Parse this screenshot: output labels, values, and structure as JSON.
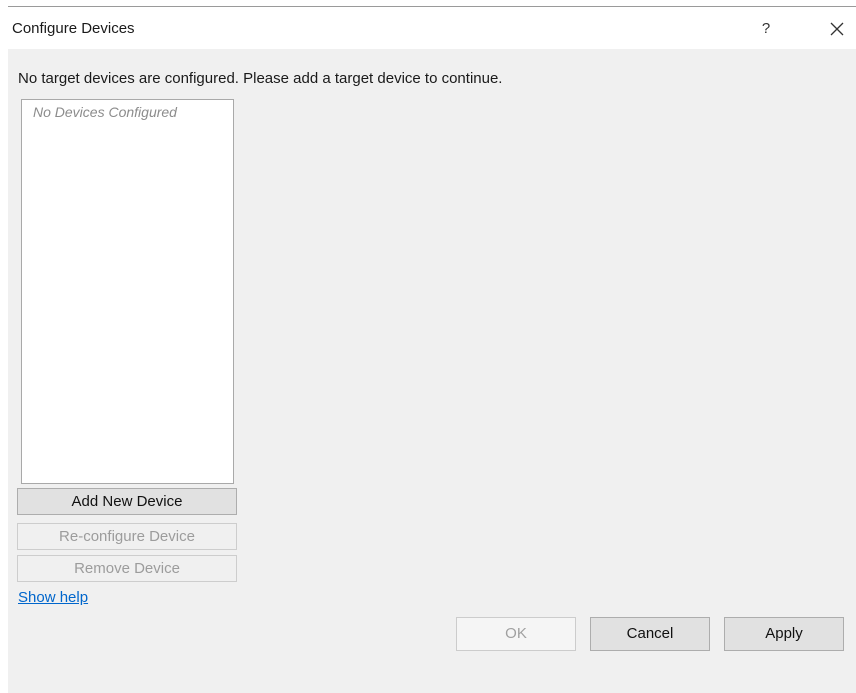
{
  "window": {
    "title": "Configure Devices",
    "help_label": "?",
    "close_icon": "close-icon"
  },
  "message": "No target devices are configured. Please add a target device to continue.",
  "device_list": {
    "empty_text": "No Devices Configured",
    "items": []
  },
  "buttons": {
    "add_new_device": "Add New Device",
    "reconfigure_device": "Re-configure Device",
    "remove_device": "Remove Device",
    "ok": "OK",
    "cancel": "Cancel",
    "apply": "Apply"
  },
  "help_link": "Show help",
  "colors": {
    "dialog_bg": "#f0f0f0",
    "link": "#0066cc",
    "disabled_text": "#9c9c9c"
  }
}
